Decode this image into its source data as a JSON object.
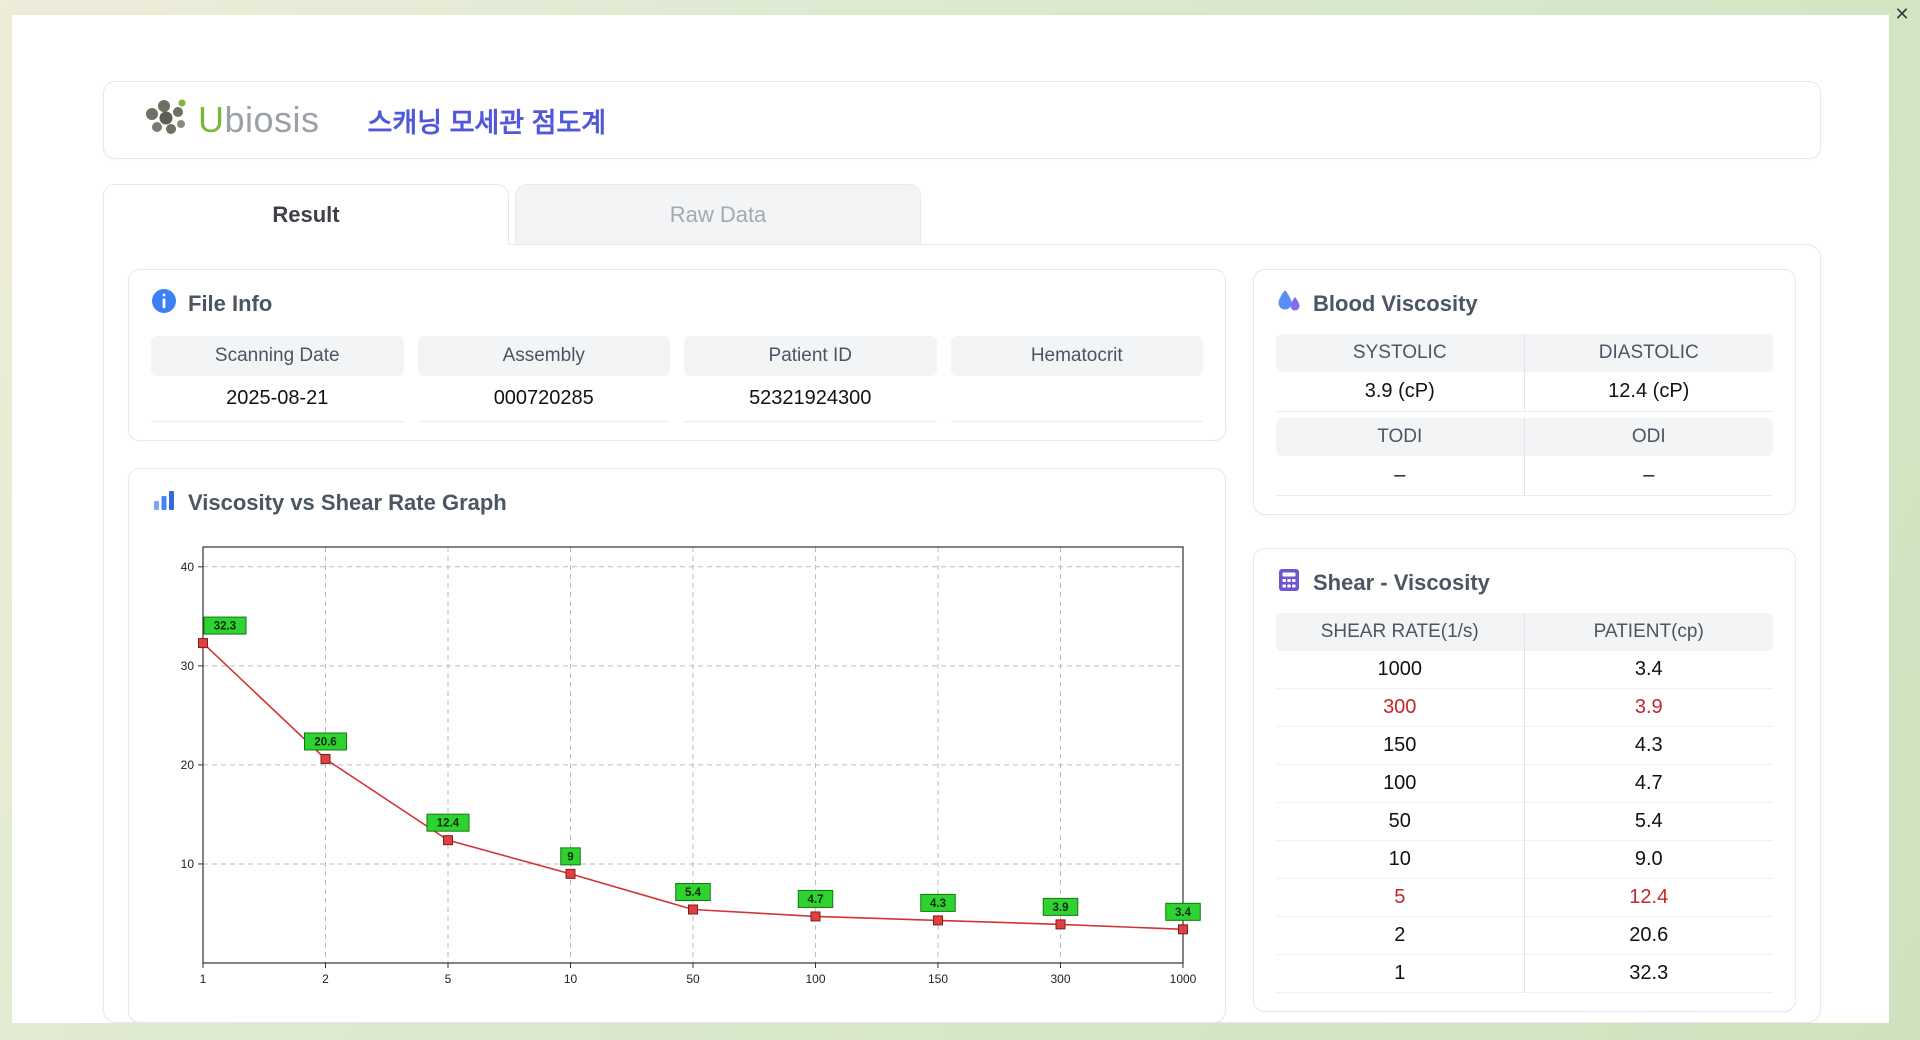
{
  "window": {
    "close": "✕"
  },
  "header": {
    "logo_u": "U",
    "logo_rest": "biosis",
    "title": "스캐닝 모세관 점도계"
  },
  "tabs": {
    "result": "Result",
    "raw": "Raw Data"
  },
  "file_info": {
    "title": "File Info",
    "fields": [
      {
        "label": "Scanning Date",
        "value": "2025-08-21"
      },
      {
        "label": "Assembly",
        "value": "000720285"
      },
      {
        "label": "Patient ID",
        "value": "52321924300"
      },
      {
        "label": "Hematocrit",
        "value": ""
      }
    ]
  },
  "graph": {
    "title": "Viscosity vs Shear Rate Graph"
  },
  "blood_viscosity": {
    "title": "Blood Viscosity",
    "row1": {
      "h1": "SYSTOLIC",
      "h2": "DIASTOLIC",
      "v1": "3.9 (cP)",
      "v2": "12.4 (cP)"
    },
    "row2": {
      "h1": "TODI",
      "h2": "ODI",
      "v1": "–",
      "v2": "–"
    }
  },
  "shear_viscosity": {
    "title": "Shear - Viscosity",
    "col1": "SHEAR RATE(1/s)",
    "col2": "PATIENT(cp)",
    "rows": [
      {
        "shear": "1000",
        "patient": "3.4"
      },
      {
        "shear": "300",
        "patient": "3.9"
      },
      {
        "shear": "150",
        "patient": "4.3"
      },
      {
        "shear": "100",
        "patient": "4.7"
      },
      {
        "shear": "50",
        "patient": "5.4"
      },
      {
        "shear": "10",
        "patient": "9.0"
      },
      {
        "shear": "5",
        "patient": "12.4"
      },
      {
        "shear": "2",
        "patient": "20.6"
      },
      {
        "shear": "1",
        "patient": "32.3"
      }
    ]
  },
  "chart_data": {
    "type": "line",
    "title": "Viscosity vs Shear Rate Graph",
    "xlabel": "",
    "ylabel": "",
    "x": [
      1,
      2,
      5,
      10,
      50,
      100,
      150,
      300,
      1000
    ],
    "x_axis": "category",
    "values": [
      32.3,
      20.6,
      12.4,
      9,
      5.4,
      4.7,
      4.3,
      3.9,
      3.4
    ],
    "labels": [
      "32.3",
      "20.6",
      "12.4",
      "9",
      "5.4",
      "4.7",
      "4.3",
      "3.9",
      "3.4"
    ],
    "yticks": [
      10,
      20,
      30,
      40
    ],
    "ylim": [
      0,
      42
    ],
    "grid": true,
    "legend": false,
    "line_color": "#cf3535",
    "marker_color": "#e04040",
    "marker_edge": "#7f1d1d",
    "label_bg": "#2fd32f",
    "label_border": "#0f7a0f"
  }
}
